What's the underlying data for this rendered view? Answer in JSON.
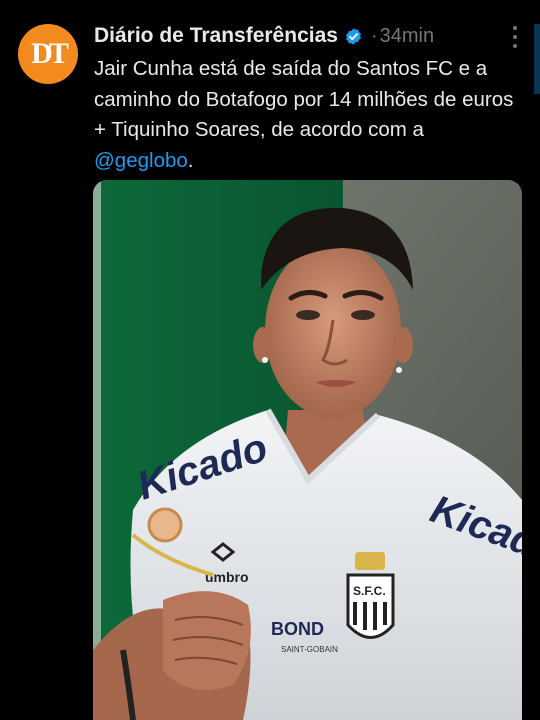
{
  "tweet": {
    "author_name": "Diário de Transferências",
    "separator": "·",
    "time": "34min",
    "text_main": "Jair Cunha está de saída do Santos FC e a caminho do Botafogo por 14 milhões de euros + Tiquinho Soares, de acordo com a ",
    "mention": "@geglobo",
    "text_end": "."
  },
  "avatar": {
    "monogram": "DT",
    "color": "#f28a1e"
  },
  "media": {
    "shirt_brand": "umbro",
    "sponsor": "BOND",
    "sponsor_sub": "SAINT-GOBAIN",
    "crest": "S.F.C."
  },
  "colors": {
    "accent": "#1d9bf0",
    "muted": "#71767b",
    "text": "#e7e9ea",
    "background": "#000000"
  }
}
